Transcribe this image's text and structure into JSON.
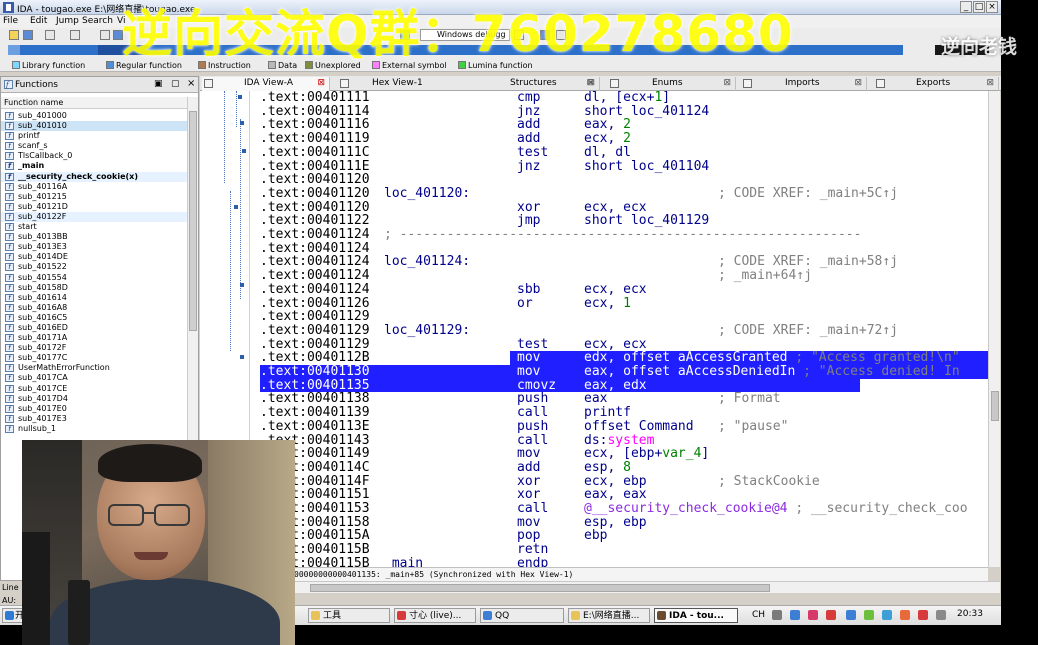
{
  "window": {
    "title": "IDA - tougao.exe E:\\网络直播\\tougao.exe",
    "buttons": [
      "_",
      "□",
      "×"
    ]
  },
  "menubar": [
    "File",
    "Edit",
    "Jump",
    "Search",
    "Vi"
  ],
  "toolbar": {
    "debugger": "Windows debugg"
  },
  "legend": [
    {
      "label": "Library function",
      "color": "#7fd7ff"
    },
    {
      "label": "Regular function",
      "color": "#4f8fd8"
    },
    {
      "label": "Instruction",
      "color": "#b07a50"
    },
    {
      "label": "Data",
      "color": "#b8b8b8"
    },
    {
      "label": "Unexplored",
      "color": "#7d8f3c"
    },
    {
      "label": "External symbol",
      "color": "#ff80ff"
    },
    {
      "label": "Lumina function",
      "color": "#3fcf3f"
    }
  ],
  "functions_panel": {
    "title": "Functions",
    "column": "Function name",
    "items": [
      {
        "name": "sub_401000",
        "style": ""
      },
      {
        "name": "sub_401010",
        "style": "sel"
      },
      {
        "name": "printf",
        "style": ""
      },
      {
        "name": "scanf_s",
        "style": ""
      },
      {
        "name": "TlsCallback_0",
        "style": ""
      },
      {
        "name": "_main",
        "style": "bold"
      },
      {
        "name": "__security_check_cookie(x)",
        "style": "bold hl"
      },
      {
        "name": "sub_40116A",
        "style": ""
      },
      {
        "name": "sub_401215",
        "style": ""
      },
      {
        "name": "sub_40121D",
        "style": ""
      },
      {
        "name": "sub_40122F",
        "style": "hl"
      },
      {
        "name": "start",
        "style": ""
      },
      {
        "name": "sub_4013BB",
        "style": ""
      },
      {
        "name": "sub_4013E3",
        "style": ""
      },
      {
        "name": "sub_4014DE",
        "style": ""
      },
      {
        "name": "sub_401522",
        "style": ""
      },
      {
        "name": "sub_401554",
        "style": ""
      },
      {
        "name": "sub_40158D",
        "style": ""
      },
      {
        "name": "sub_401614",
        "style": ""
      },
      {
        "name": "sub_4016A8",
        "style": ""
      },
      {
        "name": "sub_4016C5",
        "style": ""
      },
      {
        "name": "sub_4016ED",
        "style": ""
      },
      {
        "name": "sub_40171A",
        "style": ""
      },
      {
        "name": "sub_40172F",
        "style": ""
      },
      {
        "name": "sub_40177C",
        "style": ""
      },
      {
        "name": "UserMathErrorFunction",
        "style": ""
      },
      {
        "name": "sub_4017CA",
        "style": ""
      },
      {
        "name": "sub_4017CE",
        "style": ""
      },
      {
        "name": "sub_4017D4",
        "style": ""
      },
      {
        "name": "sub_4017E0",
        "style": ""
      },
      {
        "name": "sub_4017E3",
        "style": ""
      },
      {
        "name": "nullsub_1",
        "style": ""
      }
    ]
  },
  "line_label": "Line",
  "au_label": "AU:",
  "tabs": [
    {
      "label": "IDA View-A",
      "active": true
    },
    {
      "label": "Hex View-1",
      "active": false
    },
    {
      "label": "Structures",
      "active": false
    },
    {
      "label": "Enums",
      "active": false
    },
    {
      "label": "Imports",
      "active": false
    },
    {
      "label": "Exports",
      "active": false
    }
  ],
  "disasm": [
    {
      "addr": ".text:00401111",
      "label": "",
      "mn": "cmp",
      "op": "dl, [ecx+1]",
      "cm": ""
    },
    {
      "addr": ".text:00401114",
      "label": "",
      "mn": "jnz",
      "op": "short loc_401124",
      "cm": ""
    },
    {
      "addr": ".text:00401116",
      "label": "",
      "mn": "add",
      "op": "eax, 2",
      "cm": ""
    },
    {
      "addr": ".text:00401119",
      "label": "",
      "mn": "add",
      "op": "ecx, 2",
      "cm": ""
    },
    {
      "addr": ".text:0040111C",
      "label": "",
      "mn": "test",
      "op": "dl, dl",
      "cm": ""
    },
    {
      "addr": ".text:0040111E",
      "label": "",
      "mn": "jnz",
      "op": "short loc_401104",
      "cm": ""
    },
    {
      "addr": ".text:00401120",
      "label": "",
      "mn": "",
      "op": "",
      "cm": ""
    },
    {
      "addr": ".text:00401120",
      "label": "loc_401120:",
      "mn": "",
      "op": "",
      "cm": "; CODE XREF: _main+5C↑j"
    },
    {
      "addr": ".text:00401120",
      "label": "",
      "mn": "xor",
      "op": "ecx, ecx",
      "cm": ""
    },
    {
      "addr": ".text:00401122",
      "label": "",
      "mn": "jmp",
      "op": "short loc_401129",
      "cm": ""
    },
    {
      "addr": ".text:00401124",
      "label": "; -----------------------------------------------------------",
      "mn": "",
      "op": "",
      "cm": "",
      "sep": true
    },
    {
      "addr": ".text:00401124",
      "label": "",
      "mn": "",
      "op": "",
      "cm": ""
    },
    {
      "addr": ".text:00401124",
      "label": "loc_401124:",
      "mn": "",
      "op": "",
      "cm": "; CODE XREF: _main+58↑j"
    },
    {
      "addr": ".text:00401124",
      "label": "",
      "mn": "",
      "op": "",
      "cm": "; _main+64↑j"
    },
    {
      "addr": ".text:00401124",
      "label": "",
      "mn": "sbb",
      "op": "ecx, ecx",
      "cm": ""
    },
    {
      "addr": ".text:00401126",
      "label": "",
      "mn": "or",
      "op": "ecx, 1",
      "cm": ""
    },
    {
      "addr": ".text:00401129",
      "label": "",
      "mn": "",
      "op": "",
      "cm": ""
    },
    {
      "addr": ".text:00401129",
      "label": "loc_401129:",
      "mn": "",
      "op": "",
      "cm": "; CODE XREF: _main+72↑j"
    },
    {
      "addr": ".text:00401129",
      "label": "",
      "mn": "test",
      "op": "ecx, ecx",
      "cm": ""
    },
    {
      "addr": ".text:0040112B",
      "label": "",
      "mn": "mov",
      "op": "edx, offset aAccessGranted ; \"Access granted!\\n\"",
      "cm": "",
      "sel": 2
    },
    {
      "addr": ".text:00401130",
      "label": "",
      "mn": "mov",
      "op": "eax, offset aAccessDeniedIn ; \"Access denied! In",
      "cm": "",
      "sel": 3
    },
    {
      "addr": ".text:00401135",
      "label": "",
      "mn": "cmovz",
      "op": "eax, edx",
      "cm": "",
      "sel": 3
    },
    {
      "addr": ".text:00401138",
      "label": "",
      "mn": "push",
      "op": "eax",
      "cm": "; Format"
    },
    {
      "addr": ".text:00401139",
      "label": "",
      "mn": "call",
      "op": "printf",
      "cm": ""
    },
    {
      "addr": ".text:0040113E",
      "label": "",
      "mn": "push",
      "op": "offset Command",
      "cm": "; \"pause\""
    },
    {
      "addr": ".text:00401143",
      "label": "",
      "mn": "call",
      "op": "ds:system",
      "cm": ""
    },
    {
      "addr": ".text:00401149",
      "label": "",
      "mn": "mov",
      "op": "ecx, [ebp+var_4]",
      "cm": ""
    },
    {
      "addr": ".text:0040114C",
      "label": "",
      "mn": "add",
      "op": "esp, 8",
      "cm": ""
    },
    {
      "addr": ".text:0040114F",
      "label": "",
      "mn": "xor",
      "op": "ecx, ebp",
      "cm": "; StackCookie"
    },
    {
      "addr": ".text:00401151",
      "label": "",
      "mn": "xor",
      "op": "eax, eax",
      "cm": ""
    },
    {
      "addr": ".text:00401153",
      "label": "",
      "mn": "call",
      "op": "@__security_check_cookie@4 ; __security_check_coo",
      "cm": ""
    },
    {
      "addr": ".text:00401158",
      "label": "",
      "mn": "mov",
      "op": "esp, ebp",
      "cm": ""
    },
    {
      "addr": ".text:0040115A",
      "label": "",
      "mn": "pop",
      "op": "ebp",
      "cm": ""
    },
    {
      "addr": ".text:0040115B",
      "label": "",
      "mn": "retn",
      "op": "",
      "cm": ""
    },
    {
      "addr": ".text:0040115B",
      "label": "_main",
      "mn": "endp",
      "op": "",
      "cm": ""
    }
  ],
  "statusline": "00000000000401135: _main+85 (Synchronized with Hex View-1)",
  "taskbar": {
    "start": "开",
    "items": [
      {
        "label": "工具",
        "color": "#e8c35a",
        "active": false
      },
      {
        "label": "寸心 (live)...",
        "color": "#d63a3a",
        "active": false
      },
      {
        "label": "QQ",
        "color": "#3d7fd5",
        "active": false
      },
      {
        "label": "E:\\网络直播...",
        "color": "#e8c35a",
        "active": false
      },
      {
        "label": "IDA - tou...",
        "color": "#6a4b2f",
        "active": true
      }
    ],
    "tray_label": "CH",
    "clock": "20:33"
  },
  "overlay": {
    "watermark": "逆向交流Q群：760278680",
    "brand": "逆向老钱"
  }
}
